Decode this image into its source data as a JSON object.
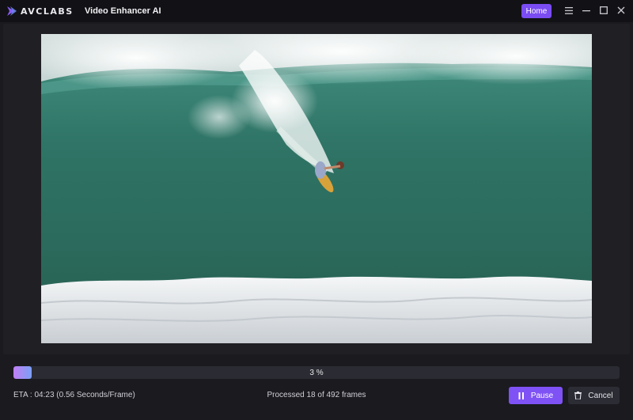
{
  "titlebar": {
    "brand": "AVCLABS",
    "app_title": "Video Enhancer AI",
    "home_label": "Home",
    "controls": [
      "menu-icon",
      "minimize-icon",
      "maximize-icon",
      "close-icon"
    ]
  },
  "preview": {
    "image": "surfer riding large green ocean wave with white foam"
  },
  "progress": {
    "percent": 3,
    "label": "3 %"
  },
  "status": {
    "eta": "ETA : 04:23 (0.56 Seconds/Frame)",
    "processed": "Processed 18 of 492 frames"
  },
  "actions": {
    "pause_label": "Pause",
    "cancel_label": "Cancel"
  },
  "colors": {
    "accent": "#7a4cf2",
    "background": "#1a1a1f",
    "titlebar": "#121216"
  }
}
